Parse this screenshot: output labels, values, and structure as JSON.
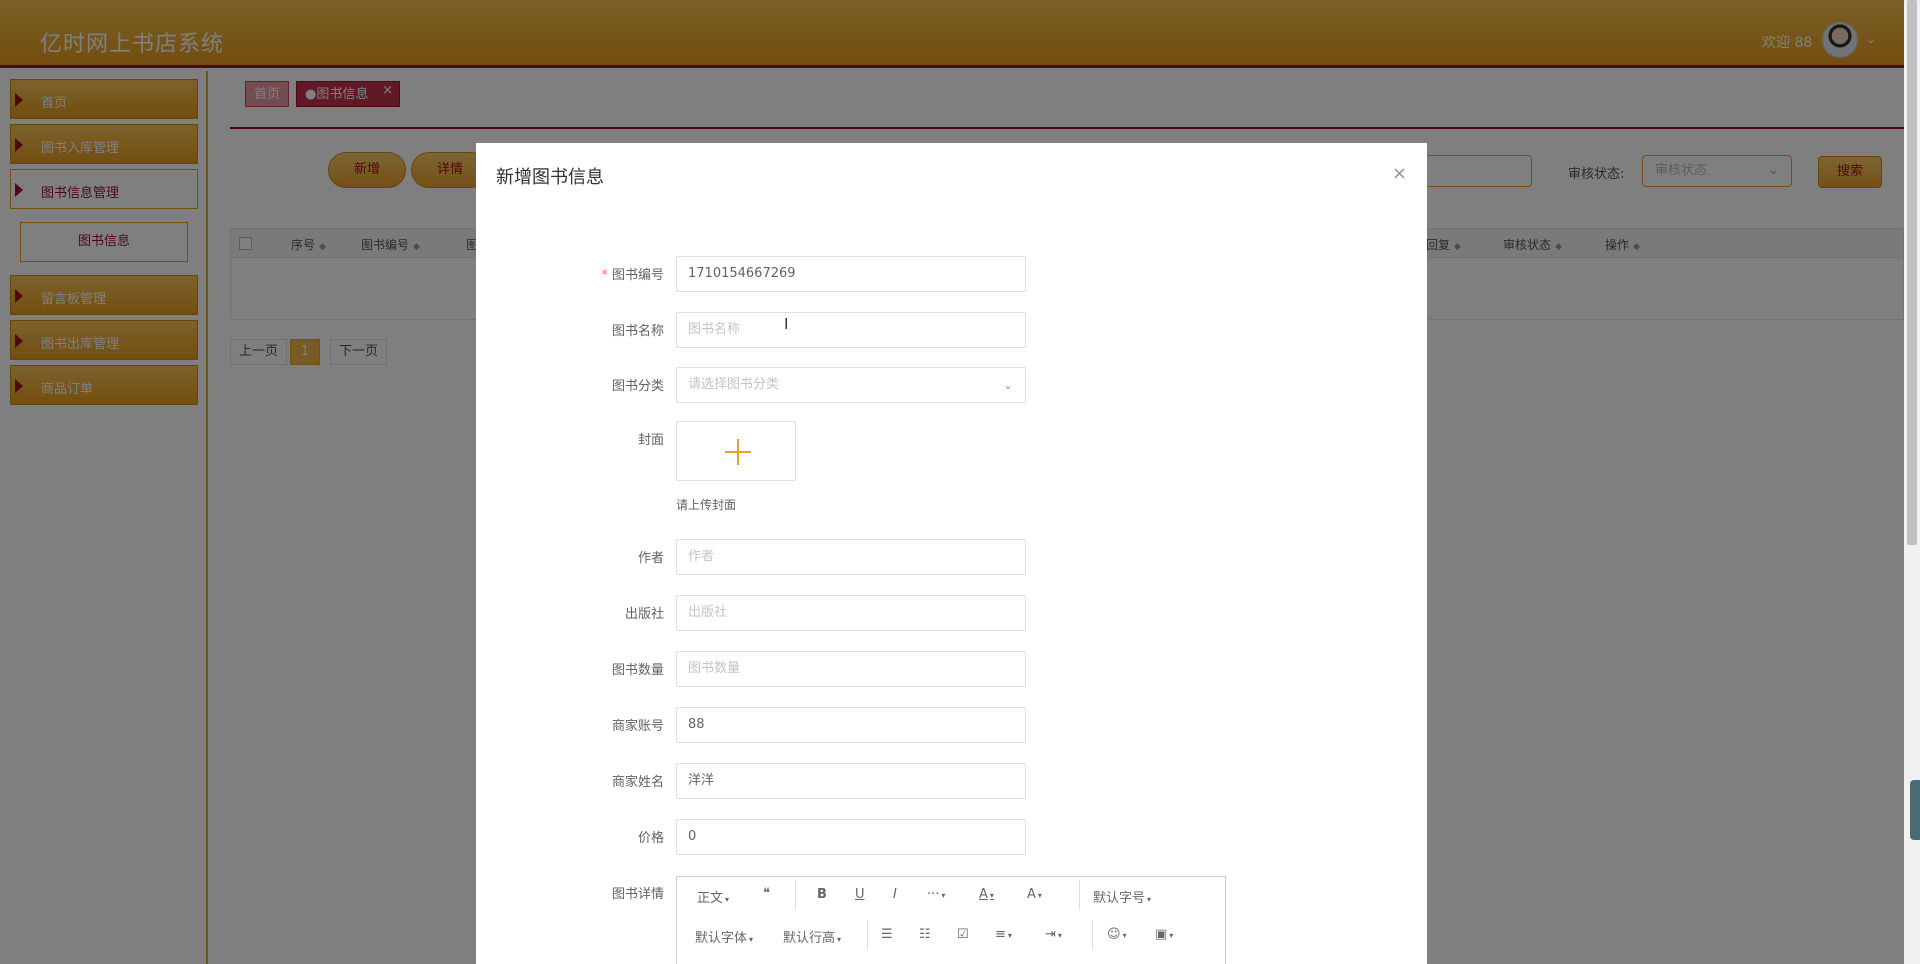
{
  "app": {
    "title": "亿时网上书店系统",
    "welcome": "欢迎 88",
    "caret": "⌄"
  },
  "sidebar": {
    "items": [
      {
        "label": "首页"
      },
      {
        "label": "图书入库管理"
      },
      {
        "label": "图书信息管理"
      },
      {
        "label": "留言板管理"
      },
      {
        "label": "图书出库管理"
      },
      {
        "label": "商品订单"
      }
    ],
    "sub_item": "图书信息"
  },
  "tabs": {
    "home": "首页",
    "current": "●图书信息",
    "close": "×"
  },
  "toolbar": {
    "add": "新增",
    "detail": "详情",
    "audit_label": "审核状态:",
    "audit_placeholder": "审核状态",
    "search": "搜索"
  },
  "table": {
    "headers": [
      "序号",
      "图书编号",
      "图",
      "回复",
      "审核状态",
      "操作"
    ]
  },
  "pagination": {
    "prev": "上一页",
    "page": "1",
    "next": "下一页"
  },
  "modal": {
    "title": "新增图书信息",
    "close": "×",
    "fields": {
      "book_no": {
        "label": "图书编号",
        "value": "1710154667269",
        "required": true
      },
      "book_name": {
        "label": "图书名称",
        "placeholder": "图书名称"
      },
      "category": {
        "label": "图书分类",
        "placeholder": "请选择图书分类"
      },
      "cover": {
        "label": "封面",
        "tip": "请上传封面"
      },
      "author": {
        "label": "作者",
        "placeholder": "作者"
      },
      "publisher": {
        "label": "出版社",
        "placeholder": "出版社"
      },
      "quantity": {
        "label": "图书数量",
        "placeholder": "图书数量"
      },
      "merchant_account": {
        "label": "商家账号",
        "value": "88"
      },
      "merchant_name": {
        "label": "商家姓名",
        "value": "洋洋"
      },
      "price": {
        "label": "价格",
        "value": "0"
      },
      "detail": {
        "label": "图书详情"
      }
    },
    "editor": {
      "row1": [
        "正文",
        "❝",
        "B",
        "U",
        "I",
        "···",
        "A",
        "A",
        "默认字号"
      ],
      "row2": [
        "默认字体",
        "默认行高",
        "☰",
        "☷",
        "☑",
        "≡",
        "⇥",
        "☺",
        "▣"
      ]
    }
  },
  "colors": {
    "brand_orange": "#e79b1e",
    "brand_red": "#a0102a",
    "required": "#f56c6c"
  }
}
